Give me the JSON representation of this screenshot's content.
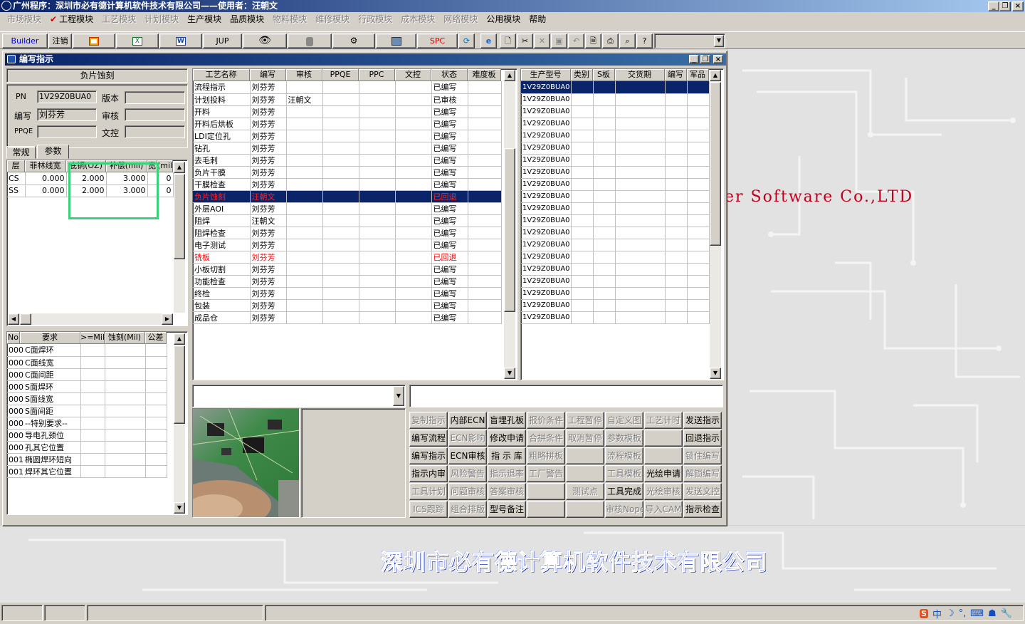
{
  "app": {
    "title": "广州程序：深圳市必有德计算机软件技术有限公司——使用者：汪朝文",
    "minimize": "_",
    "maximize": "▫",
    "close": "×"
  },
  "menu": [
    {
      "label": "市场模块",
      "disabled": true
    },
    {
      "label": "工程模块",
      "disabled": false,
      "checked": true
    },
    {
      "label": "工艺模块",
      "disabled": true
    },
    {
      "label": "计划模块",
      "disabled": true
    },
    {
      "label": "生产模块",
      "disabled": false
    },
    {
      "label": "品质模块",
      "disabled": false
    },
    {
      "label": "物料模块",
      "disabled": true
    },
    {
      "label": "维修模块",
      "disabled": true
    },
    {
      "label": "行政模块",
      "disabled": true
    },
    {
      "label": "成本模块",
      "disabled": true
    },
    {
      "label": "网络模块",
      "disabled": true
    },
    {
      "label": "公用模块",
      "disabled": false
    },
    {
      "label": "帮助",
      "disabled": false
    }
  ],
  "toolbar": {
    "builder": "Builder",
    "logout": "注销",
    "jup": "JUP",
    "spc": "SPC",
    "word": "W"
  },
  "window": {
    "title": "编写指示",
    "section_title": "负片蚀刻",
    "pn_label": "PN",
    "pn_value": "1V29Z0BUA0",
    "version_label": "版本",
    "version_value": "",
    "writer_label": "编写",
    "writer_value": "刘芬芳",
    "review_label": "审核",
    "review_value": "",
    "ppqe_label": "PPQE",
    "ppqe_value": "",
    "doc_label": "文控",
    "doc_value": "",
    "tabs": [
      "常规",
      "参数"
    ]
  },
  "param_table": {
    "headers": [
      "层",
      "菲林线宽",
      "底铜(OZ)",
      "补偿(mil)",
      "宽",
      "(mil"
    ],
    "rows": [
      [
        "CS",
        "0.000",
        "2.000",
        "3.000",
        "",
        "0"
      ],
      [
        "SS",
        "0.000",
        "2.000",
        "3.000",
        "",
        "0"
      ]
    ]
  },
  "req_table": {
    "headers": [
      "No",
      "要求",
      ">=Mil",
      "蚀刻(Mil)",
      "公差"
    ],
    "rows": [
      [
        "000",
        "C面焊环"
      ],
      [
        "000",
        "C面线宽"
      ],
      [
        "000",
        "C面间距"
      ],
      [
        "000",
        "S面焊环"
      ],
      [
        "000",
        "S面线宽"
      ],
      [
        "000",
        "S面间距"
      ],
      [
        "000",
        "--特别要求--"
      ],
      [
        "000",
        "导电孔颈位"
      ],
      [
        "000",
        "孔其它位置"
      ],
      [
        "001",
        "椭圆焊环短向"
      ],
      [
        "001",
        "焊环其它位置"
      ]
    ]
  },
  "process_table": {
    "headers": [
      "工艺名称",
      "编写",
      "审核",
      "PPQE",
      "PPC",
      "文控",
      "状态",
      "难度板"
    ],
    "rows": [
      {
        "cells": [
          "流程指示",
          "刘芬芳",
          "",
          "",
          "",
          "",
          "已编写",
          ""
        ],
        "style": ""
      },
      {
        "cells": [
          "计划投料",
          "刘芬芳",
          "汪朝文",
          "",
          "",
          "",
          "已审核",
          ""
        ],
        "style": ""
      },
      {
        "cells": [
          "开料",
          "刘芬芳",
          "",
          "",
          "",
          "",
          "已编写",
          ""
        ],
        "style": ""
      },
      {
        "cells": [
          "开料后烘板",
          "刘芬芳",
          "",
          "",
          "",
          "",
          "已编写",
          ""
        ],
        "style": ""
      },
      {
        "cells": [
          "LDI定位孔",
          "刘芬芳",
          "",
          "",
          "",
          "",
          "已编写",
          ""
        ],
        "style": ""
      },
      {
        "cells": [
          "钻孔",
          "刘芬芳",
          "",
          "",
          "",
          "",
          "已编写",
          ""
        ],
        "style": ""
      },
      {
        "cells": [
          "去毛刺",
          "刘芬芳",
          "",
          "",
          "",
          "",
          "已编写",
          ""
        ],
        "style": ""
      },
      {
        "cells": [
          "负片干膜",
          "刘芬芳",
          "",
          "",
          "",
          "",
          "已编写",
          ""
        ],
        "style": ""
      },
      {
        "cells": [
          "干膜检查",
          "刘芬芳",
          "",
          "",
          "",
          "",
          "已编写",
          ""
        ],
        "style": ""
      },
      {
        "cells": [
          "负片蚀刻",
          "汪朝文",
          "",
          "",
          "",
          "",
          "已回退",
          ""
        ],
        "style": "sel"
      },
      {
        "cells": [
          "外层AOI",
          "刘芬芳",
          "",
          "",
          "",
          "",
          "已编写",
          ""
        ],
        "style": ""
      },
      {
        "cells": [
          "阻焊",
          "汪朝文",
          "",
          "",
          "",
          "",
          "已编写",
          ""
        ],
        "style": ""
      },
      {
        "cells": [
          "阻焊检查",
          "刘芬芳",
          "",
          "",
          "",
          "",
          "已编写",
          ""
        ],
        "style": ""
      },
      {
        "cells": [
          "电子测试",
          "刘芬芳",
          "",
          "",
          "",
          "",
          "已编写",
          ""
        ],
        "style": ""
      },
      {
        "cells": [
          "铣板",
          "刘芬芳",
          "",
          "",
          "",
          "",
          "已回退",
          ""
        ],
        "style": "red"
      },
      {
        "cells": [
          "小板切割",
          "刘芬芳",
          "",
          "",
          "",
          "",
          "已编写",
          ""
        ],
        "style": ""
      },
      {
        "cells": [
          "功能检查",
          "刘芬芳",
          "",
          "",
          "",
          "",
          "已编写",
          ""
        ],
        "style": ""
      },
      {
        "cells": [
          "终检",
          "刘芬芳",
          "",
          "",
          "",
          "",
          "已编写",
          ""
        ],
        "style": ""
      },
      {
        "cells": [
          "包装",
          "刘芬芳",
          "",
          "",
          "",
          "",
          "已编写",
          ""
        ],
        "style": ""
      },
      {
        "cells": [
          "成品仓",
          "刘芬芳",
          "",
          "",
          "",
          "",
          "已编写",
          ""
        ],
        "style": ""
      }
    ]
  },
  "model_table": {
    "headers": [
      "生产型号",
      "类别",
      "S板",
      "交货期",
      "编写",
      "军品"
    ],
    "rows": [
      "1V29Z0BUA0",
      "1V29Z0BUA0",
      "1V29Z0BUA0",
      "1V29Z0BUA0",
      "1V29Z0BUA0",
      "1V29Z0BUA0",
      "1V29Z0BUA0",
      "1V29Z0BUA0",
      "1V29Z0BUA0",
      "1V29Z0BUA0",
      "1V29Z0BUA0",
      "1V29Z0BUA0",
      "1V29Z0BUA0",
      "1V29Z0BUA0",
      "1V29Z0BUA0",
      "1V29Z0BUA0",
      "1V29Z0BUA0",
      "1V29Z0BUA0",
      "1V29Z0BUA0",
      "1V29Z0BUA0"
    ]
  },
  "action_buttons": [
    [
      {
        "label": "复制指示",
        "d": true
      },
      {
        "label": "内部ECN",
        "d": false
      },
      {
        "label": "盲埋孔板",
        "d": false
      },
      {
        "label": "报价条件",
        "d": true
      },
      {
        "label": "工程暂停",
        "d": true
      },
      {
        "label": "自定义图",
        "d": true
      },
      {
        "label": "工艺计时",
        "d": true
      },
      {
        "label": "发送指示",
        "d": false
      }
    ],
    [
      {
        "label": "编写流程",
        "d": false
      },
      {
        "label": "ECN影响",
        "d": true
      },
      {
        "label": "修改申请",
        "d": false
      },
      {
        "label": "合拼条件",
        "d": true
      },
      {
        "label": "取消暂停",
        "d": true
      },
      {
        "label": "参数模板",
        "d": true
      },
      {
        "label": "",
        "d": true
      },
      {
        "label": "回退指示",
        "d": false
      }
    ],
    [
      {
        "label": "编写指示",
        "d": false
      },
      {
        "label": "ECN审核",
        "d": false
      },
      {
        "label": "指 示 库",
        "d": false
      },
      {
        "label": "粗略拼板",
        "d": true
      },
      {
        "label": "",
        "d": true
      },
      {
        "label": "流程模板",
        "d": true
      },
      {
        "label": "",
        "d": true
      },
      {
        "label": "锁住编写",
        "d": true
      }
    ],
    [
      {
        "label": "指示内审",
        "d": false
      },
      {
        "label": "风险警告",
        "d": true
      },
      {
        "label": "指示退率",
        "d": true
      },
      {
        "label": "工厂警告",
        "d": true
      },
      {
        "label": "",
        "d": true
      },
      {
        "label": "工具模板",
        "d": true
      },
      {
        "label": "光绘申请",
        "d": false
      },
      {
        "label": "解锁编写",
        "d": true
      }
    ],
    [
      {
        "label": "工具计划",
        "d": true
      },
      {
        "label": "问题审核",
        "d": true
      },
      {
        "label": "答案审核",
        "d": true
      },
      {
        "label": "",
        "d": true
      },
      {
        "label": "测试点",
        "d": true
      },
      {
        "label": "工具完成",
        "d": false
      },
      {
        "label": "光绘审核",
        "d": true
      },
      {
        "label": "发送文控",
        "d": true
      }
    ],
    [
      {
        "label": "ICS跟踪",
        "d": true
      },
      {
        "label": "组合排版",
        "d": true
      },
      {
        "label": "型号备注",
        "d": false
      },
      {
        "label": "",
        "d": true
      },
      {
        "label": "",
        "d": true
      },
      {
        "label": "审核Nope",
        "d": true
      },
      {
        "label": "导入CAM",
        "d": true
      },
      {
        "label": "指示检查",
        "d": false
      }
    ]
  ],
  "background": {
    "watermark": "er Software Co.,LTD",
    "company": "深圳市必有德计算机软件技术有限公司"
  },
  "tray": {
    "items": [
      "中",
      "°,",
      "⌨"
    ]
  },
  "colors": {
    "title_bar": "#0a246a",
    "selection": "#0a246a",
    "highlight_box": "#39d27a",
    "red_text": "#ff0000"
  }
}
